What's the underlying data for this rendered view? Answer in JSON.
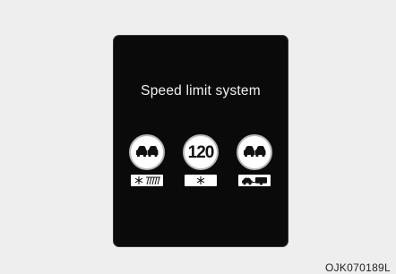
{
  "display": {
    "title": "Speed limit system",
    "background_color": "#0a0a0a",
    "text_color": "#f2f2f2"
  },
  "signs": [
    {
      "type": "no-overtaking",
      "icon": "no-overtaking-cars-icon",
      "sub_plate_icon": "snow-and-rain-icon"
    },
    {
      "type": "speed-limit",
      "value": "120",
      "sub_plate_icon": "snowflake-icon"
    },
    {
      "type": "no-overtaking",
      "icon": "no-overtaking-cars-icon",
      "sub_plate_icon": "car-with-trailer-icon"
    }
  ],
  "image_code": "OJK070189L"
}
